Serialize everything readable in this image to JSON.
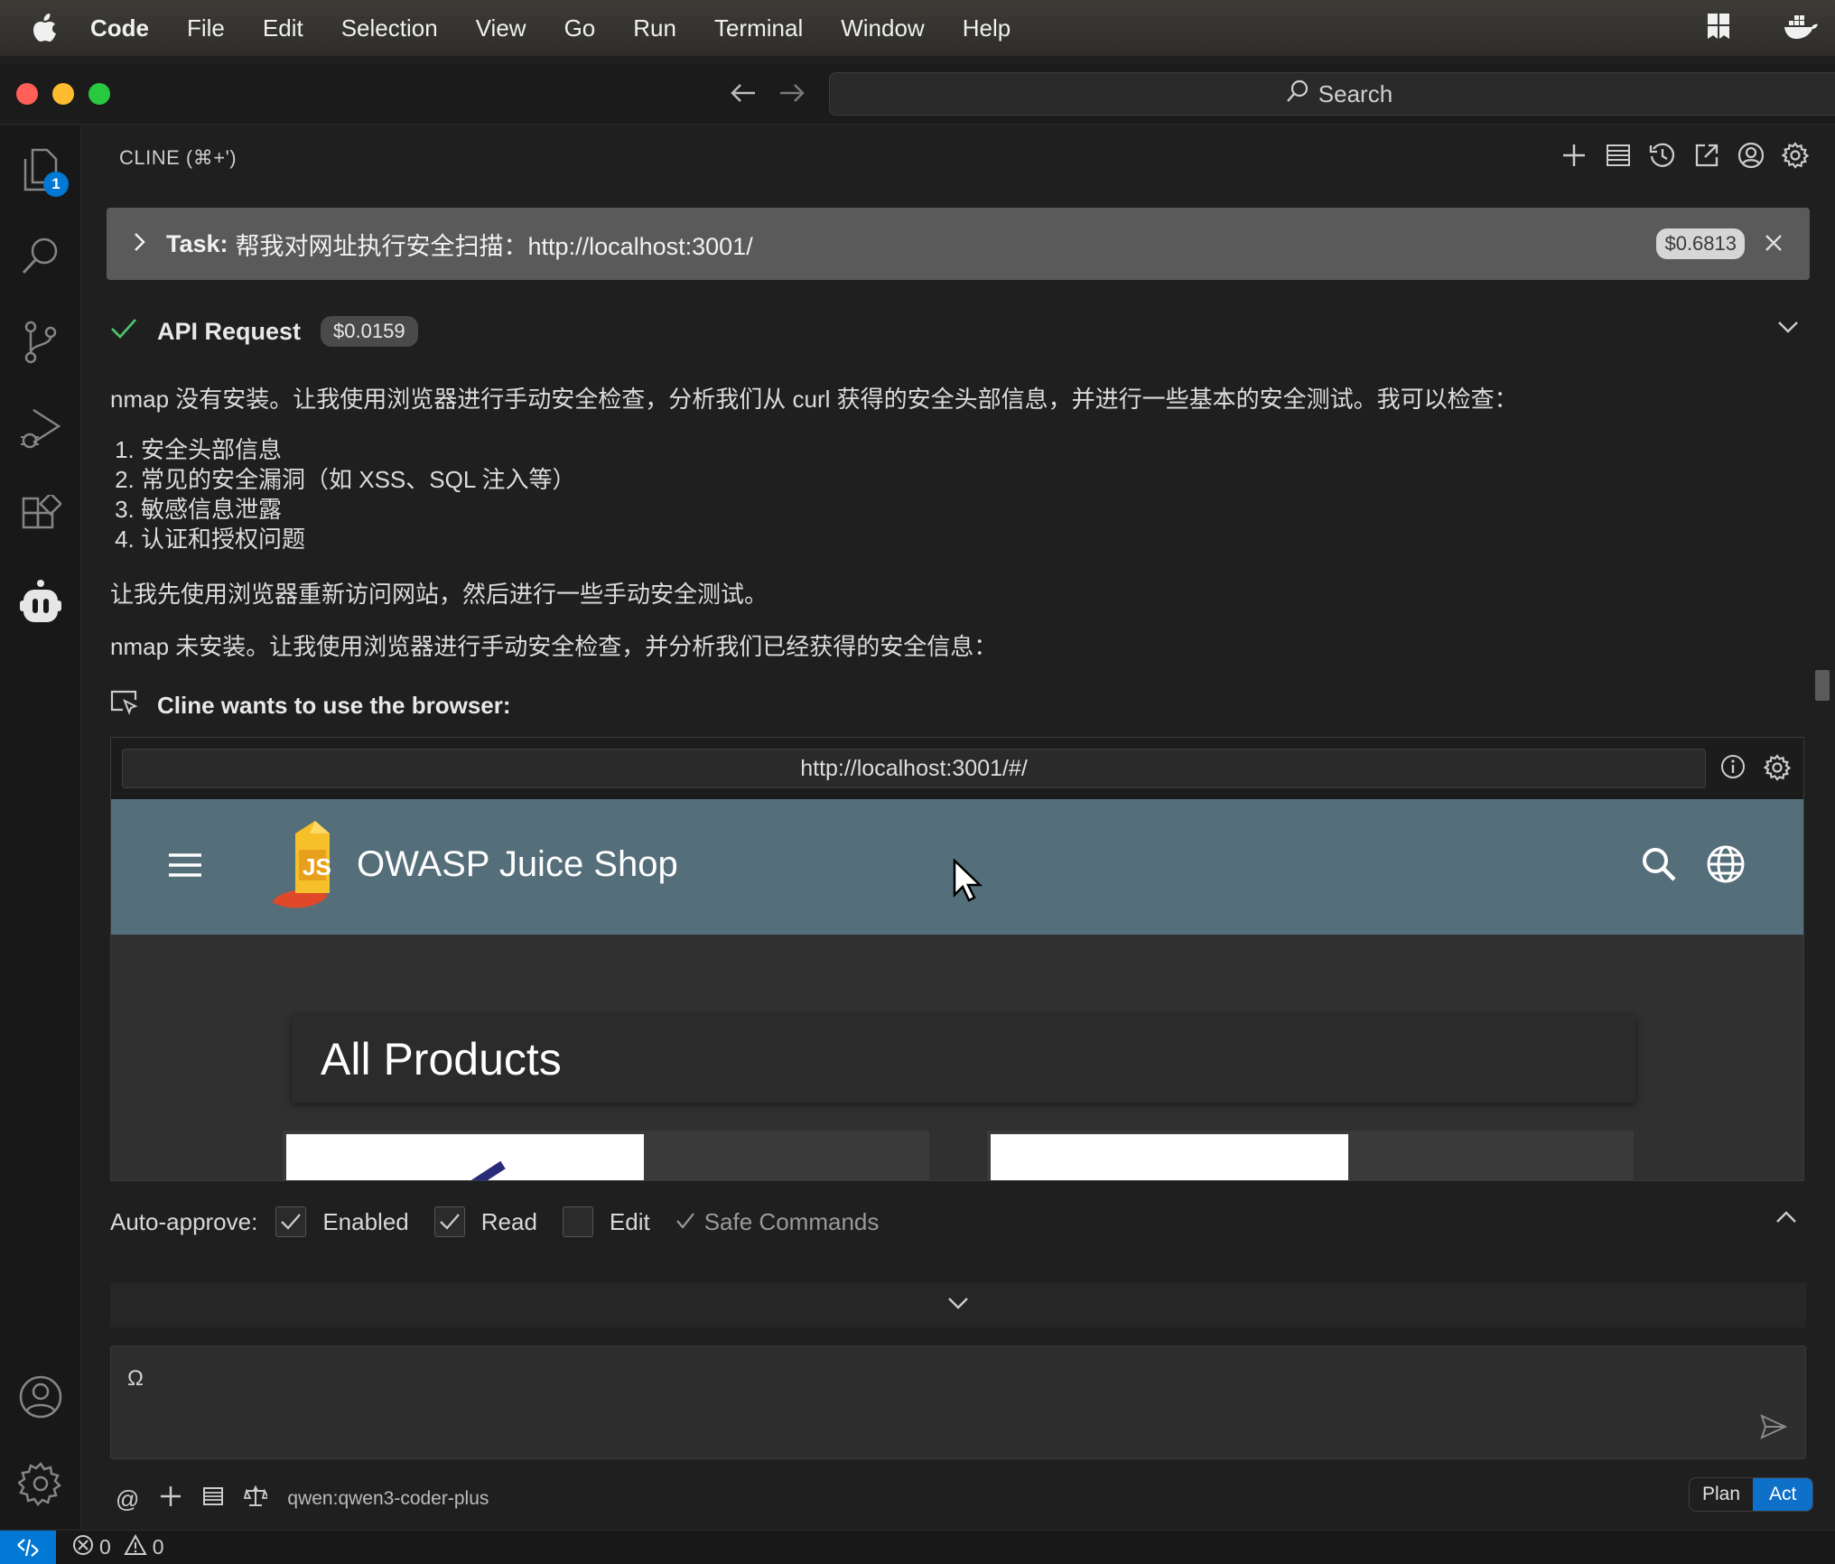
{
  "menubar": {
    "app": "Code",
    "items": [
      "File",
      "Edit",
      "Selection",
      "View",
      "Go",
      "Run",
      "Terminal",
      "Window",
      "Help"
    ]
  },
  "titlebar": {
    "search_label": "Search"
  },
  "activitybar": {
    "explorer_badge": "1"
  },
  "panel": {
    "title": "CLINE (⌘+')"
  },
  "task": {
    "label": "Task:",
    "text": "帮我对网址执行安全扫描：http://localhost:3001/",
    "cost": "$0.6813"
  },
  "api_request": {
    "label": "API Request",
    "cost": "$0.0159"
  },
  "message": {
    "intro": "nmap 没有安装。让我使用浏览器进行手动安全检查，分析我们从 curl 获得的安全头部信息，并进行一些基本的安全测试。我可以检查：",
    "list": [
      "安全头部信息",
      "常见的安全漏洞（如 XSS、SQL 注入等）",
      "敏感信息泄露",
      "认证和授权问题"
    ],
    "line2": "让我先使用浏览器重新访问网站，然后进行一些手动安全测试。",
    "line3": "nmap 未安装。让我使用浏览器进行手动安全检查，并分析我们已经获得的安全信息："
  },
  "browser": {
    "header": "Cline wants to use the browser:",
    "url": "http://localhost:3001/#/",
    "shop_title": "OWASP Juice Shop",
    "section_title": "All Products"
  },
  "auto_approve": {
    "label": "Auto-approve:",
    "options": [
      {
        "label": "Enabled",
        "checked": true
      },
      {
        "label": "Read",
        "checked": true
      },
      {
        "label": "Edit",
        "checked": false
      }
    ],
    "safe_commands": "Safe Commands"
  },
  "input": {
    "placeholder": "Ω"
  },
  "bottom": {
    "model": "qwen:qwen3-coder-plus",
    "plan": "Plan",
    "act": "Act"
  },
  "status": {
    "errors": "0",
    "warnings": "0"
  },
  "colors": {
    "accent": "#0078d4",
    "shop_toolbar": "#546e7a",
    "success_check": "#4ec26b"
  }
}
